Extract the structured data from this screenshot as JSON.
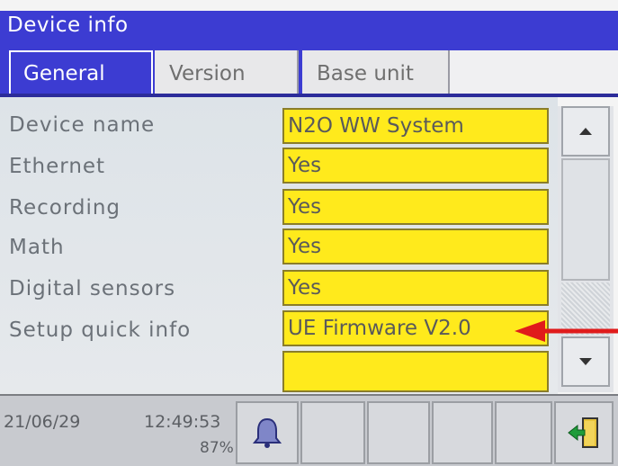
{
  "window": {
    "title": "Device info"
  },
  "tabs": [
    {
      "label": "General",
      "active": true
    },
    {
      "label": "Version",
      "active": false
    },
    {
      "label": "Base unit",
      "active": false
    }
  ],
  "rows": [
    {
      "label": "Device name",
      "value": "N2O WW System"
    },
    {
      "label": "Ethernet",
      "value": "Yes"
    },
    {
      "label": "Recording",
      "value": "Yes"
    },
    {
      "label": "Math",
      "value": "Yes"
    },
    {
      "label": "Digital sensors",
      "value": "Yes"
    },
    {
      "label": "Setup quick info",
      "value": "UE Firmware V2.0"
    },
    {
      "label": "",
      "value": ""
    }
  ],
  "scrollbar": {
    "up_icon": "triangle-up-icon",
    "down_icon": "triangle-down-icon"
  },
  "status": {
    "date": "21/06/29",
    "time": "12:49:53",
    "memory_percent": "87%",
    "bell_icon": "bell-icon",
    "exit_icon": "exit-door-icon"
  },
  "colors": {
    "header_blue": "#3c3cd2",
    "value_yellow": "#ffea1c",
    "annotation_red": "#e01b1b"
  }
}
